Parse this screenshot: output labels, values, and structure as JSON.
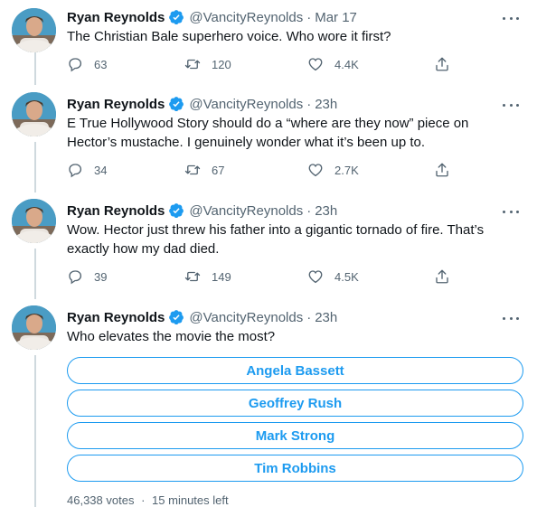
{
  "theme": {
    "accent": "#1d9bf0",
    "text": "#0f1419",
    "muted": "#536471",
    "line": "#cfd9de"
  },
  "tweets": [
    {
      "author": "Ryan Reynolds",
      "handle": "@VancityReynolds",
      "separator": "·",
      "time": "Mar 17",
      "text": "The Christian Bale superhero voice. Who wore it first?",
      "replies": "63",
      "retweets": "120",
      "likes": "4.4K"
    },
    {
      "author": "Ryan Reynolds",
      "handle": "@VancityReynolds",
      "separator": "·",
      "time": "23h",
      "text": "E True Hollywood Story should do a “where are they now” piece on Hector’s mustache. I genuinely wonder what it’s been up to.",
      "replies": "34",
      "retweets": "67",
      "likes": "2.7K"
    },
    {
      "author": "Ryan Reynolds",
      "handle": "@VancityReynolds",
      "separator": "·",
      "time": "23h",
      "text": "Wow. Hector just threw his father into a gigantic tornado of fire. That’s exactly how my dad died.",
      "replies": "39",
      "retweets": "149",
      "likes": "4.5K"
    },
    {
      "author": "Ryan Reynolds",
      "handle": "@VancityReynolds",
      "separator": "·",
      "time": "23h",
      "text": "Who elevates the movie the most?",
      "poll": {
        "options": [
          "Angela Bassett",
          "Geoffrey Rush",
          "Mark Strong",
          "Tim Robbins"
        ],
        "votes": "46,338 votes",
        "separator": "·",
        "time_left": "15 minutes left"
      }
    }
  ],
  "icons": {
    "verified": "verified-badge-icon",
    "more": "more-dots-icon",
    "reply": "reply-icon",
    "retweet": "retweet-icon",
    "like": "heart-icon",
    "share": "share-icon"
  }
}
